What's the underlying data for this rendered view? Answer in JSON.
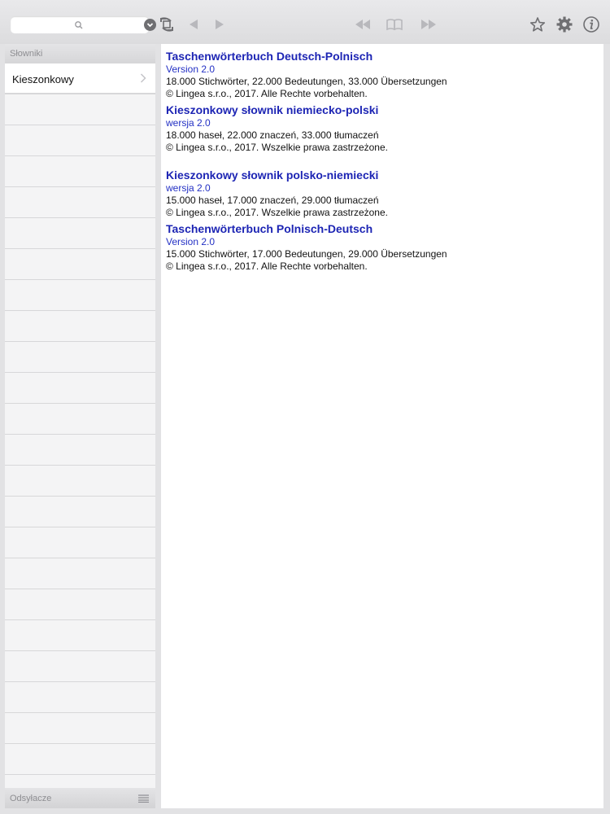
{
  "search": {
    "value": "",
    "placeholder": ""
  },
  "icons": {
    "search": "search-icon",
    "dropdown": "chevron-down-circle-icon",
    "sync": "sync-icon",
    "back": "arrow-left-icon",
    "forward": "arrow-right-icon",
    "prev_entry": "rewind-icon",
    "book": "book-icon",
    "next_entry": "fast-forward-icon",
    "favorite": "star-icon",
    "settings": "gear-icon",
    "info": "info-icon",
    "list": "list-icon",
    "chevron": "chevron-right-icon"
  },
  "colors": {
    "link_title": "#1d25b4",
    "version": "#2330c4",
    "toolbar_icon_active": "#6f6f72",
    "toolbar_icon_disabled": "#b8b8bc"
  },
  "sidebar": {
    "header": "Słowniki",
    "items": [
      {
        "label": "Kieszonkowy"
      }
    ],
    "footer": "Odsyłacze"
  },
  "dictionaries": [
    {
      "title": "Taschenwörterbuch Deutsch-Polnisch",
      "version": "Version 2.0",
      "stats": "18.000 Stichwörter, 22.000 Bedeutungen, 33.000 Übersetzungen",
      "copyright": "© Lingea s.r.o., 2017. Alle Rechte vorbehalten."
    },
    {
      "title": "Kieszonkowy słownik niemiecko-polski",
      "version": "wersja 2.0",
      "stats": "18.000 haseł, 22.000 znaczeń, 33.000 tłumaczeń",
      "copyright": "© Lingea s.r.o., 2017. Wszelkie prawa zastrzeżone."
    },
    {
      "title": "Kieszonkowy słownik polsko-niemiecki",
      "version": "wersja 2.0",
      "stats": "15.000 haseł, 17.000 znaczeń, 29.000 tłumaczeń",
      "copyright": "© Lingea s.r.o., 2017. Wszelkie prawa zastrzeżone."
    },
    {
      "title": "Taschenwörterbuch Polnisch-Deutsch",
      "version": "Version 2.0",
      "stats": "15.000 Stichwörter, 17.000 Bedeutungen, 29.000 Übersetzungen",
      "copyright": "© Lingea s.r.o., 2017. Alle Rechte vorbehalten."
    }
  ]
}
